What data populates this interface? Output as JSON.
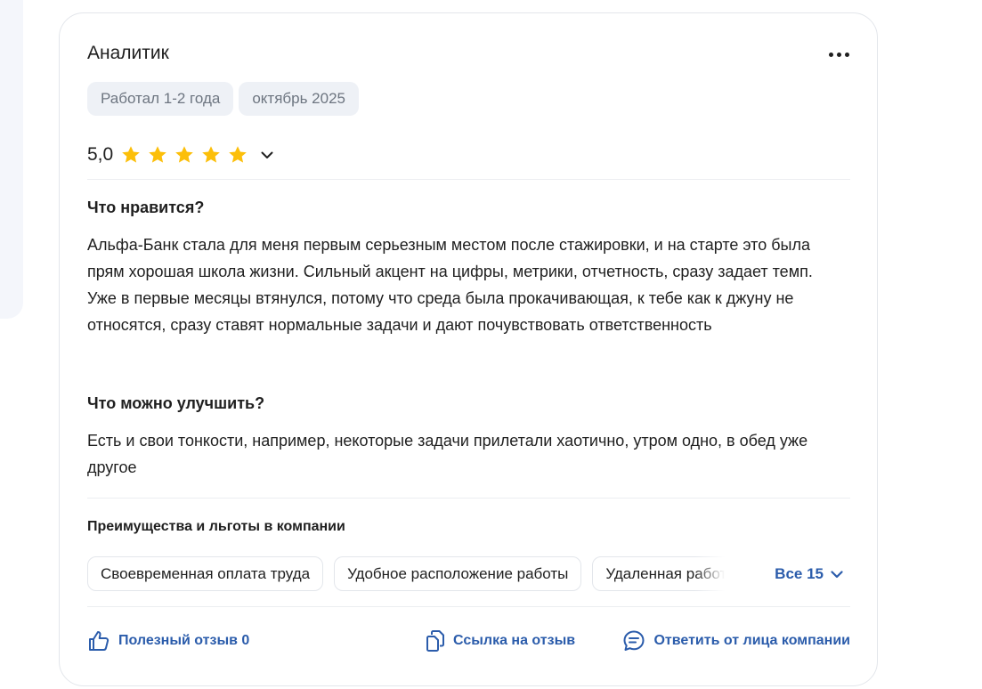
{
  "review": {
    "title": "Аналитик",
    "tags": [
      "Работал 1-2 года",
      "октябрь 2025"
    ],
    "rating": "5,0",
    "stars": 5,
    "likes_heading": "Что нравится?",
    "likes_text": "Альфа-Банк стала для меня первым серьезным местом после стажировки, и на старте это была прям хорошая школа жизни. Сильный акцент на цифры, метрики, отчетность, сразу задает темп. Уже в первые месяцы втянулся, потому что среда была прокачивающая, к тебе как к джуну не относятся, сразу ставят нормальные задачи и дают почувствовать ответственность",
    "improve_heading": "Что можно улучшить?",
    "improve_text": "Есть и свои тонкости, например, некоторые задачи прилетали хаотично, утром одно, в обед уже другое"
  },
  "benefits": {
    "heading": "Преимущества и льготы в компании",
    "items": [
      "Своевременная оплата труда",
      "Удобное расположение работы",
      "Удаленная работа"
    ],
    "all_label": "Все 15"
  },
  "actions": {
    "helpful": "Полезный отзыв 0",
    "link": "Ссылка на отзыв",
    "reply": "Ответить от лица компании"
  },
  "colors": {
    "accent": "#2b5cab",
    "star": "#fcbf0a",
    "tag_bg": "#eef1f6"
  },
  "icons": [
    "more-icon",
    "star-icon",
    "chevron-down-icon",
    "thumbs-up-icon",
    "copy-link-icon",
    "reply-icon"
  ]
}
